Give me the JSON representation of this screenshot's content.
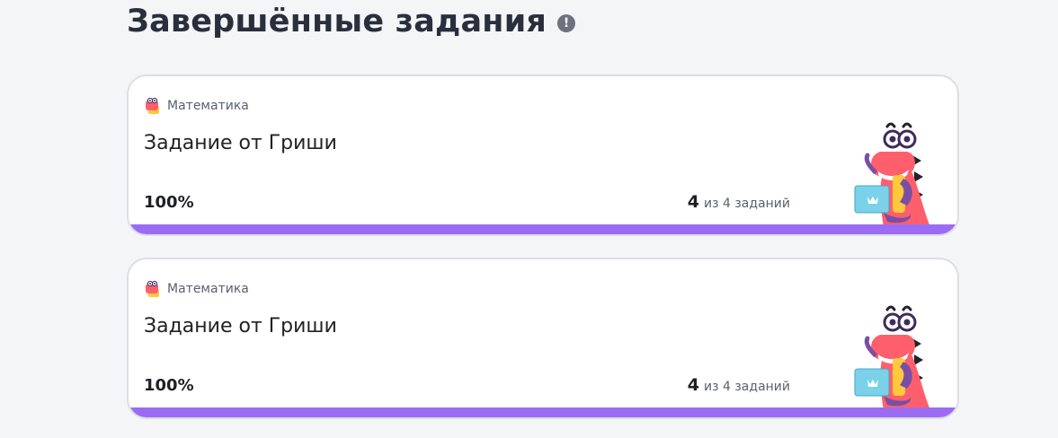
{
  "page": {
    "title": "Завершённые задания",
    "info_icon": "exclamation-info-icon"
  },
  "colors": {
    "accent": "#9b6cf3",
    "background": "#f4f5f7",
    "card": "#ffffff",
    "mascot": "#ff5f6d"
  },
  "cards": [
    {
      "subject": "Математика",
      "subject_icon": "math-dragon-icon",
      "title": "Задание от Гриши",
      "percent": "100%",
      "progress": 1.0,
      "done": "4",
      "total_text": "из 4 заданий",
      "mascot": "dragon-mascot-with-laptop"
    },
    {
      "subject": "Математика",
      "subject_icon": "math-dragon-icon",
      "title": "Задание от Гриши",
      "percent": "100%",
      "progress": 1.0,
      "done": "4",
      "total_text": "из 4 заданий",
      "mascot": "dragon-mascot-with-laptop"
    }
  ]
}
